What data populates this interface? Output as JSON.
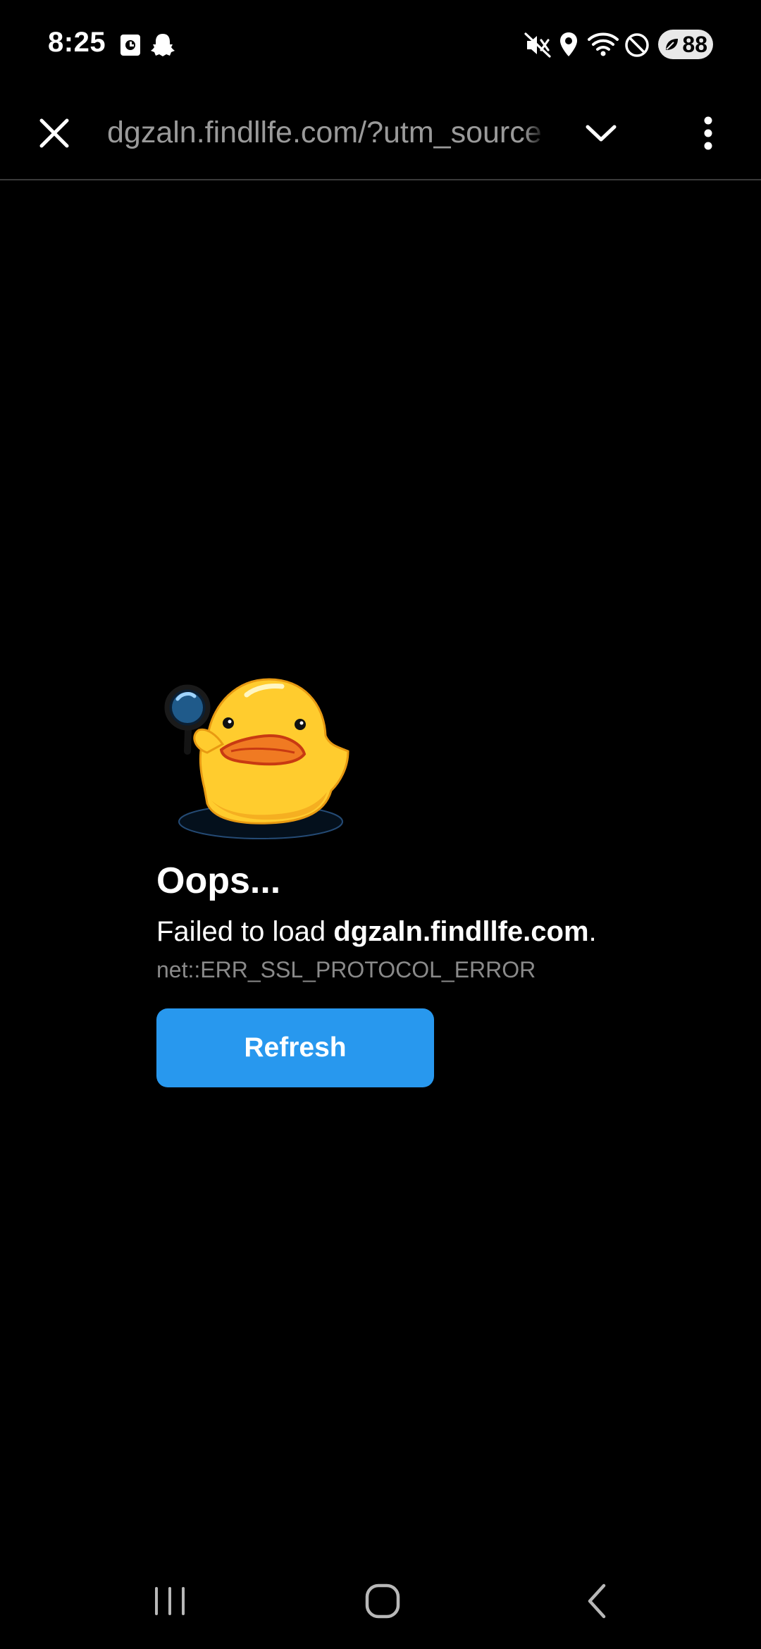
{
  "status_bar": {
    "time": "8:25",
    "battery_level": "88",
    "icons": [
      "screenshot-icon",
      "snapchat-icon",
      "mute-icon",
      "location-icon",
      "wifi-icon",
      "do-not-disturb-icon",
      "battery-icon"
    ]
  },
  "toolbar": {
    "url": "dgzaln.findllfe.com/?utm_source",
    "icons": [
      "close-icon",
      "chevron-down-icon",
      "more-vert-icon"
    ]
  },
  "error": {
    "title": "Oops...",
    "message_prefix": "Failed to load ",
    "host": "dgzaln.findllfe.com",
    "message_suffix": ".",
    "code": "net::ERR_SSL_PROTOCOL_ERROR",
    "refresh_label": "Refresh",
    "illustration": "duck-with-magnifier"
  },
  "nav_bar": {
    "icons": [
      "recent-apps-icon",
      "home-icon",
      "back-icon"
    ]
  },
  "colors": {
    "background": "#000000",
    "accent": "#2898ee",
    "url_text": "#9a9a9a",
    "error_code": "#8a8a8a"
  }
}
